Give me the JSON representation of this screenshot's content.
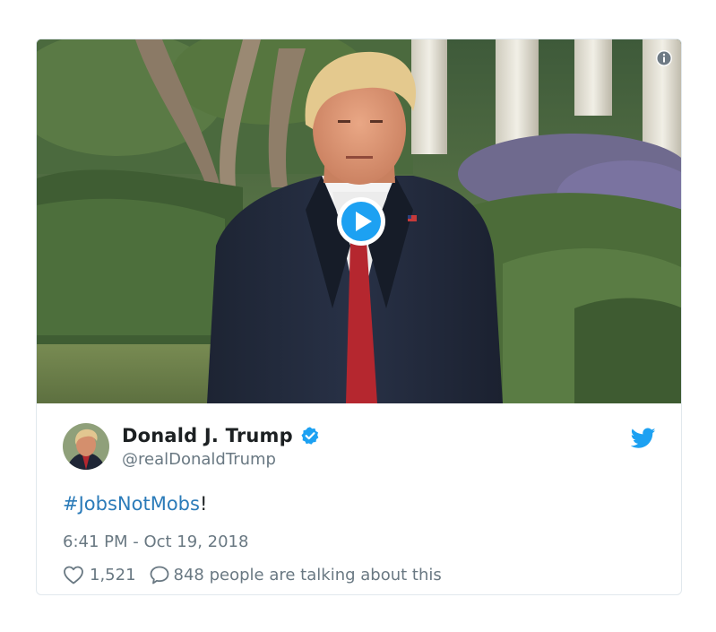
{
  "tweet": {
    "author_name": "Donald J. Trump",
    "handle": "@realDonaldTrump",
    "text_hashtag": "#JobsNotMobs",
    "text_suffix": "!",
    "timestamp": "6:41 PM - Oct 19, 2018",
    "like_count": "1,521",
    "talking_text": "848 people are talking about this"
  },
  "icons": {
    "info": "info-icon",
    "play": "play-icon",
    "verified": "verified-badge-icon",
    "brand": "twitter-bird-icon",
    "like": "heart-icon",
    "reply": "speech-bubble-icon"
  },
  "colors": {
    "link": "#2b7bb9",
    "verified": "#1da1f2",
    "brand": "#1da1f2",
    "text": "#1c2022",
    "muted": "#697882",
    "border": "#e1e8ed"
  }
}
